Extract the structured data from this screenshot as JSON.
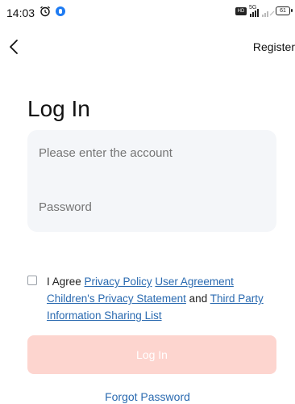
{
  "status_bar": {
    "time": "14:03",
    "hd_badge": "HD",
    "network_label": "5G",
    "battery_level": "61"
  },
  "header": {
    "register_label": "Register"
  },
  "page_title": "Log In",
  "form": {
    "account_placeholder": "Please enter the account",
    "password_placeholder": "Password",
    "account_value": "",
    "password_value": ""
  },
  "agreement": {
    "prefix": "I Agree",
    "privacy_policy": "Privacy Policy",
    "user_agreement": "User Agreement",
    "childrens_privacy": "Children's Privacy Statement",
    "and": "and",
    "third_party": "Third Party Information Sharing List",
    "checked": false
  },
  "login_button_label": "Log In",
  "forgot_password_label": "Forgot Password",
  "colors": {
    "link": "#2a6ab0",
    "login_button_disabled": "#fdd5cf",
    "input_card": "#f4f6f9"
  }
}
